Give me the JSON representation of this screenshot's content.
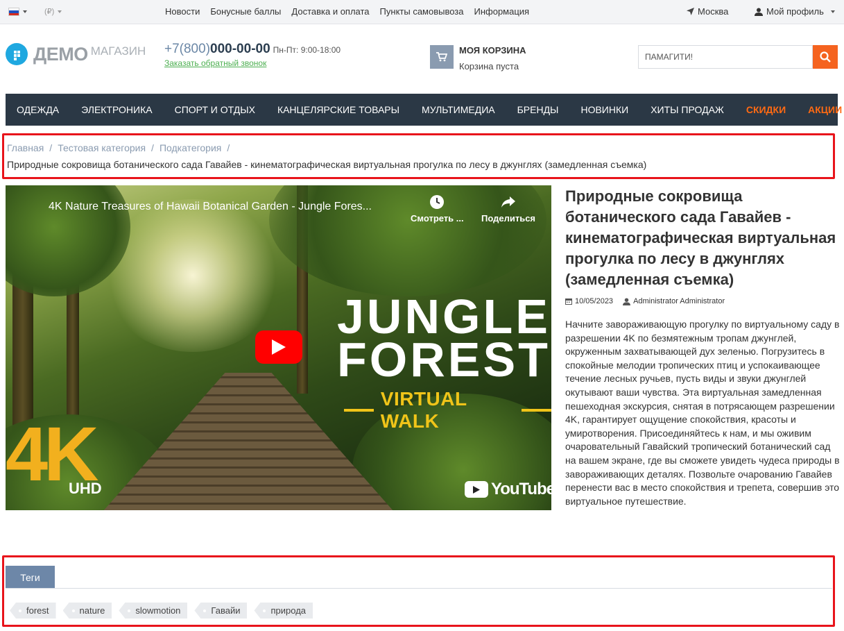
{
  "topbar": {
    "currency": "(₽)",
    "menu": [
      "Новости",
      "Бонусные баллы",
      "Доставка и оплата",
      "Пункты самовывоза",
      "Информация"
    ],
    "city": "Москва",
    "profile": "Мой профиль"
  },
  "header": {
    "logo_main": "ДЕМО",
    "logo_sub": "МАГАЗИН",
    "phone_prefix": "+7(800)",
    "phone_number": "000-00-00",
    "hours": "Пн-Пт: 9:00-18:00",
    "callback": "Заказать обратный звонок",
    "cart_title": "МОЯ КОРЗИНА",
    "cart_status": "Корзина пуста",
    "search_placeholder": "ПАМАГИТИ!"
  },
  "nav": {
    "items": [
      "ОДЕЖДА",
      "ЭЛЕКТРОНИКА",
      "СПОРТ И ОТДЫХ",
      "КАНЦЕЛЯРСКИЕ ТОВАРЫ",
      "МУЛЬТИМЕДИА",
      "БРЕНДЫ",
      "НОВИНКИ",
      "ХИТЫ ПРОДАЖ"
    ],
    "sale": "СКИДКИ",
    "promo": "АКЦИИ"
  },
  "breadcrumb": {
    "items": [
      "Главная",
      "Тестовая категория",
      "Подкатегория"
    ],
    "separator": "/",
    "current": "Природные сокровища ботанического сада Гавайев - кинематографическая виртуальная прогулка по лесу в джунглях (замедленная съемка)"
  },
  "video": {
    "title": "4K Nature Treasures of Hawaii Botanical Garden - Jungle Fores...",
    "watch_later": "Смотреть ...",
    "share": "Поделиться",
    "overlay_line1": "JUNGLE",
    "overlay_line2": "FOREST",
    "overlay_sub": "VIRTUAL WALK",
    "badge": "4K",
    "badge_sub": "UHD",
    "brand": "YouTube"
  },
  "article": {
    "title": "Природные сокровища ботанического сада Гавайев - кинематографическая виртуальная прогулка по лесу в джунглях (замедленная съемка)",
    "date": "10/05/2023",
    "author": "Administrator Administrator",
    "body": "Начните завораживающую прогулку по виртуальному саду в разрешении 4K по безмятежным тропам джунглей, окруженным захватывающей дух зеленью. Погрузитесь в спокойные мелодии тропических птиц и успокаивающее течение лесных ручьев, пусть виды и звуки джунглей окутывают ваши чувства. Эта виртуальная замедленная пешеходная экскурсия, снятая в потрясающем разрешении 4K, гарантирует ощущение спокойствия, красоты и умиротворения. Присоединяйтесь к нам, и мы оживим очаровательный Гавайский тропический ботанический сад на вашем экране, где вы сможете увидеть чудеса природы в завораживающих деталях. Позвольте очарованию Гавайев перенести вас в место спокойствия и трепета, совершив это виртуальное путешествие."
  },
  "tags": {
    "tab_label": "Теги",
    "items": [
      "forest",
      "nature",
      "slowmotion",
      "Гавайи",
      "природа"
    ]
  },
  "colors": {
    "nav_bg": "#2b3845",
    "accent_orange": "#ff6a13",
    "search_button": "#f5631f",
    "tab_bg": "#6d87a8",
    "callback_link": "#4caf50",
    "annotation": "#e8141b"
  }
}
